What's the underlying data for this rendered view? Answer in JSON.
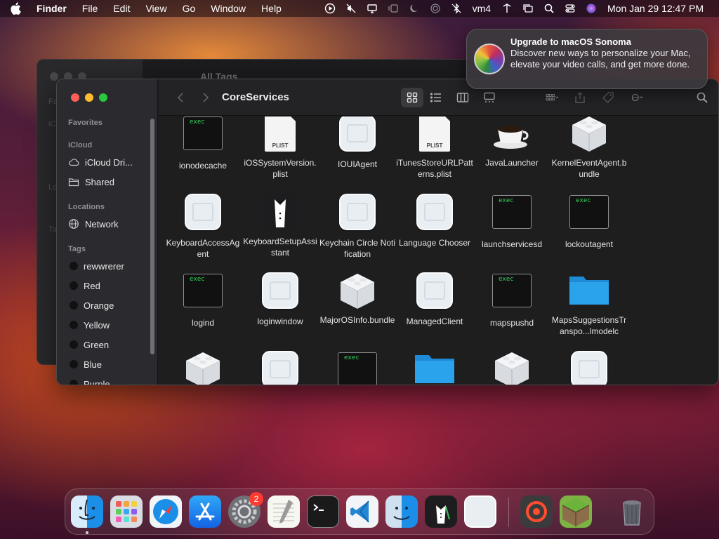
{
  "menubar": {
    "app_name": "Finder",
    "menus": [
      "File",
      "Edit",
      "View",
      "Go",
      "Window",
      "Help"
    ],
    "status_user": "vm4",
    "clock": "Mon Jan 29  12:47 PM"
  },
  "bg_window": {
    "title": "All Tags",
    "sidebar_labels": [
      "Fa",
      "iC",
      "Lo",
      "Ta"
    ]
  },
  "window": {
    "title": "CoreServices",
    "sidebar": {
      "favorites_header": "Favorites",
      "icloud_header": "iCloud",
      "icloud_items": [
        {
          "label": "iCloud Dri...",
          "icon": "cloud-icon"
        },
        {
          "label": "Shared",
          "icon": "shared-folder-icon"
        }
      ],
      "locations_header": "Locations",
      "location_items": [
        {
          "label": "Network",
          "icon": "globe-icon"
        }
      ],
      "tags_header": "Tags",
      "tags": [
        {
          "label": "rewwrerer"
        },
        {
          "label": "Red"
        },
        {
          "label": "Orange"
        },
        {
          "label": "Yellow"
        },
        {
          "label": "Green"
        },
        {
          "label": "Blue"
        },
        {
          "label": "Purple"
        }
      ]
    },
    "files": [
      {
        "name": "ionodecache",
        "kind": "exec"
      },
      {
        "name": "iOSSystemVersion.plist",
        "kind": "plist"
      },
      {
        "name": "IOUIAgent",
        "kind": "app"
      },
      {
        "name": "iTunesStoreURLPatterns.plist",
        "kind": "plist"
      },
      {
        "name": "JavaLauncher",
        "kind": "java"
      },
      {
        "name": "KernelEventAgent.bundle",
        "kind": "bundle"
      },
      {
        "name": "KeyboardAccessAgent",
        "kind": "app"
      },
      {
        "name": "KeyboardSetupAssistant",
        "kind": "tuxedo"
      },
      {
        "name": "Keychain Circle Notification",
        "kind": "app"
      },
      {
        "name": "Language Chooser",
        "kind": "app"
      },
      {
        "name": "launchservicesd",
        "kind": "exec"
      },
      {
        "name": "lockoutagent",
        "kind": "exec"
      },
      {
        "name": "logind",
        "kind": "exec"
      },
      {
        "name": "loginwindow",
        "kind": "app"
      },
      {
        "name": "MajorOSInfo.bundle",
        "kind": "bundle"
      },
      {
        "name": "ManagedClient",
        "kind": "app"
      },
      {
        "name": "mapspushd",
        "kind": "exec"
      },
      {
        "name": "MapsSuggestionsTranspo...lmodelc",
        "kind": "folder"
      },
      {
        "name": "",
        "kind": "bundle"
      },
      {
        "name": "",
        "kind": "app"
      },
      {
        "name": "",
        "kind": "exec"
      },
      {
        "name": "",
        "kind": "folder"
      },
      {
        "name": "",
        "kind": "bundle"
      },
      {
        "name": "",
        "kind": "app"
      }
    ],
    "exec_tag": "exec",
    "plist_tag": "PLIST"
  },
  "notification": {
    "title": "Upgrade to macOS Sonoma",
    "body": "Discover new ways to personalize your Mac, elevate your video calls, and get more done."
  },
  "dock": {
    "items": [
      {
        "name": "finder",
        "icon": "finder-icon",
        "running": true
      },
      {
        "name": "launchpad",
        "icon": "launchpad-icon",
        "running": false
      },
      {
        "name": "safari",
        "icon": "safari-icon",
        "running": false
      },
      {
        "name": "app-store",
        "icon": "app-store-icon",
        "running": false
      },
      {
        "name": "system-settings",
        "icon": "gear-icon",
        "running": false,
        "badge": "2"
      },
      {
        "name": "textedit",
        "icon": "notepad-icon",
        "running": false
      },
      {
        "name": "terminal",
        "icon": "terminal-icon",
        "running": false
      },
      {
        "name": "vscode",
        "icon": "vscode-icon",
        "running": false
      },
      {
        "name": "migration-assistant",
        "icon": "migration-icon",
        "running": false
      },
      {
        "name": "setup-assistant",
        "icon": "tuxedo-icon",
        "running": false
      },
      {
        "name": "generic-app",
        "icon": "generic-app-icon",
        "running": false
      },
      {
        "name": "screen-recorder",
        "icon": "record-icon",
        "running": false
      },
      {
        "name": "minecraft",
        "icon": "grass-block-icon",
        "running": false
      },
      {
        "name": "trash",
        "icon": "trash-icon",
        "running": false
      }
    ],
    "badge_count": "2"
  },
  "colors": {
    "accent_red": "#ff5f57",
    "accent_yellow": "#febc2e",
    "accent_green": "#28c840",
    "exec_green": "#36d35a",
    "folder_blue": "#2aa3ec"
  }
}
